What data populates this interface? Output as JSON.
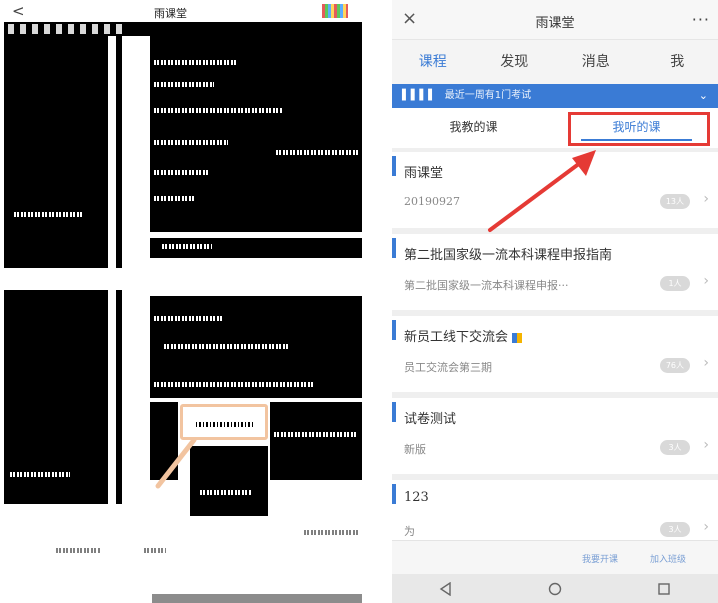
{
  "left_panel": {
    "back_glyph": "<",
    "title": "雨课堂"
  },
  "right_panel": {
    "header": {
      "close": "×",
      "title": "雨课堂",
      "more": "···"
    },
    "nav_tabs": [
      {
        "label": "课程",
        "active": true
      },
      {
        "label": "发现",
        "active": false
      },
      {
        "label": "消息",
        "active": false
      },
      {
        "label": "我",
        "active": false
      }
    ],
    "banner": {
      "text": "最近一周有1门考试"
    },
    "sub_tabs": [
      {
        "label": "我教的课",
        "active": false
      },
      {
        "label": "我听的课",
        "active": true
      }
    ],
    "courses": [
      {
        "title": "雨课堂",
        "subtitle": "20190927",
        "badge": "13人"
      },
      {
        "title": "第二批国家级一流本科课程申报指南",
        "subtitle": "第二批国家级一流本科课程申报···",
        "badge": "1人"
      },
      {
        "title": "新员工线下交流会",
        "subtitle": "员工交流会第三期",
        "badge": "76人"
      },
      {
        "title": "试卷测试",
        "subtitle": "新版",
        "badge": "3人"
      },
      {
        "title": "123",
        "subtitle": "为",
        "badge": "3人"
      }
    ],
    "footer": {
      "create_class": "我要开课",
      "join_class": "加入班级"
    },
    "colors": {
      "accent": "#3a7bd5",
      "callout": "#e53a35"
    }
  }
}
